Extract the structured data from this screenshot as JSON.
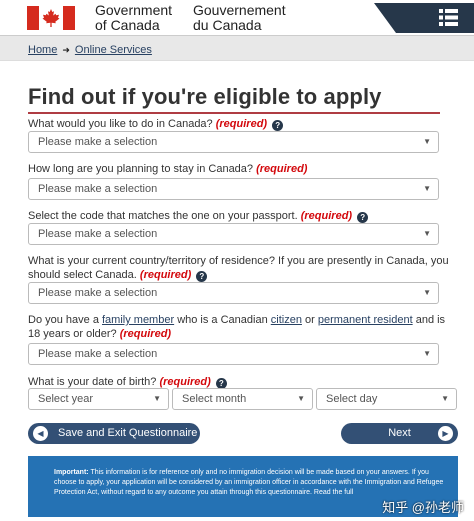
{
  "header": {
    "gov_en_line1": "Government",
    "gov_en_line2": "of Canada",
    "gov_fr_line1": "Gouvernement",
    "gov_fr_line2": "du Canada"
  },
  "breadcrumb": {
    "home": "Home",
    "online_services": "Online Services"
  },
  "page_title": "Find out if you're eligible to apply",
  "required_label": "(required)",
  "questions": {
    "q1": "What would you like to do in Canada?",
    "q2": "How long are you planning to stay in Canada?",
    "q3": "Select the code that matches the one on your passport.",
    "q4": "What is your current country/territory of residence? If you are presently in Canada, you should select Canada.",
    "q5_pre": "Do you have a",
    "q5_link1": "family member",
    "q5_mid1": "who is a Canadian",
    "q5_link2": "citizen",
    "q5_mid2": "or",
    "q5_link3": "permanent resident",
    "q5_post": "and is 18 years or older?",
    "q6": "What is your date of birth?"
  },
  "selects": {
    "placeholder": "Please make a selection",
    "year": "Select year",
    "month": "Select month",
    "day": "Select day"
  },
  "buttons": {
    "save_exit": "Save and Exit Questionnaire",
    "next": "Next"
  },
  "notice": {
    "important": "Important:",
    "text": "This information is for reference only and no immigration decision will be made based on your answers. If you choose to apply, your application will be considered by an immigration officer in accordance with the Immigration and Refugee Protection Act, without regard to any outcome you attain through this questionnaire. Read the full"
  },
  "watermark": "知乎 @孙老师"
}
